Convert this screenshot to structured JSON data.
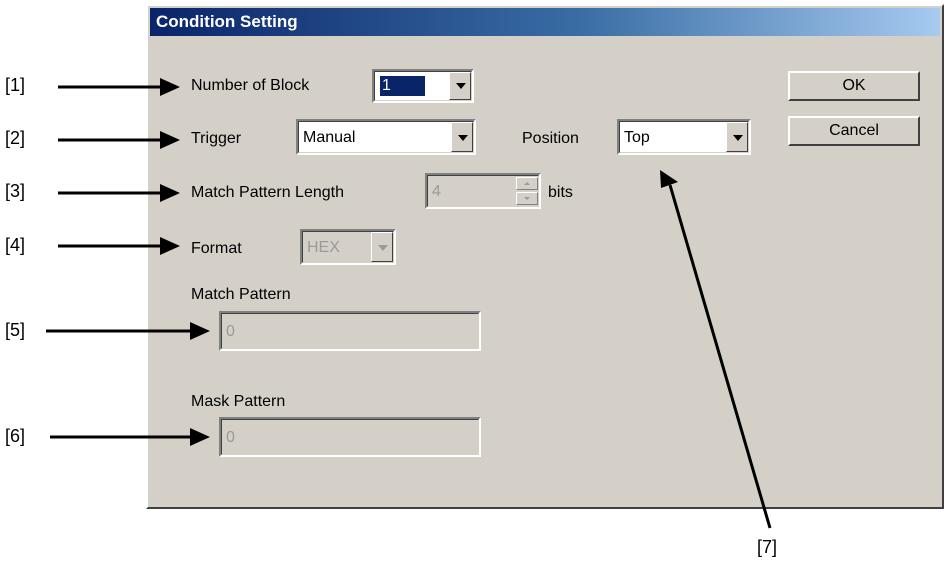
{
  "dialog": {
    "title": "Condition Setting",
    "ok_label": "OK",
    "cancel_label": "Cancel"
  },
  "fields": {
    "number_of_block": {
      "label": "Number of Block",
      "value": "1"
    },
    "trigger": {
      "label": "Trigger",
      "value": "Manual"
    },
    "position": {
      "label": "Position",
      "value": "Top"
    },
    "match_pattern_length": {
      "label": "Match Pattern Length",
      "value": "4",
      "unit": "bits"
    },
    "format": {
      "label": "Format",
      "value": "HEX"
    },
    "match_pattern": {
      "label": "Match Pattern",
      "value": "0"
    },
    "mask_pattern": {
      "label": "Mask Pattern",
      "value": "0"
    }
  },
  "callouts": [
    "[1]",
    "[2]",
    "[3]",
    "[4]",
    "[5]",
    "[6]",
    "[7]"
  ],
  "colors": {
    "title_bar_start": "#0a246a",
    "title_bar_end": "#a6caf0",
    "dialog_bg": "#d4d0c8"
  }
}
